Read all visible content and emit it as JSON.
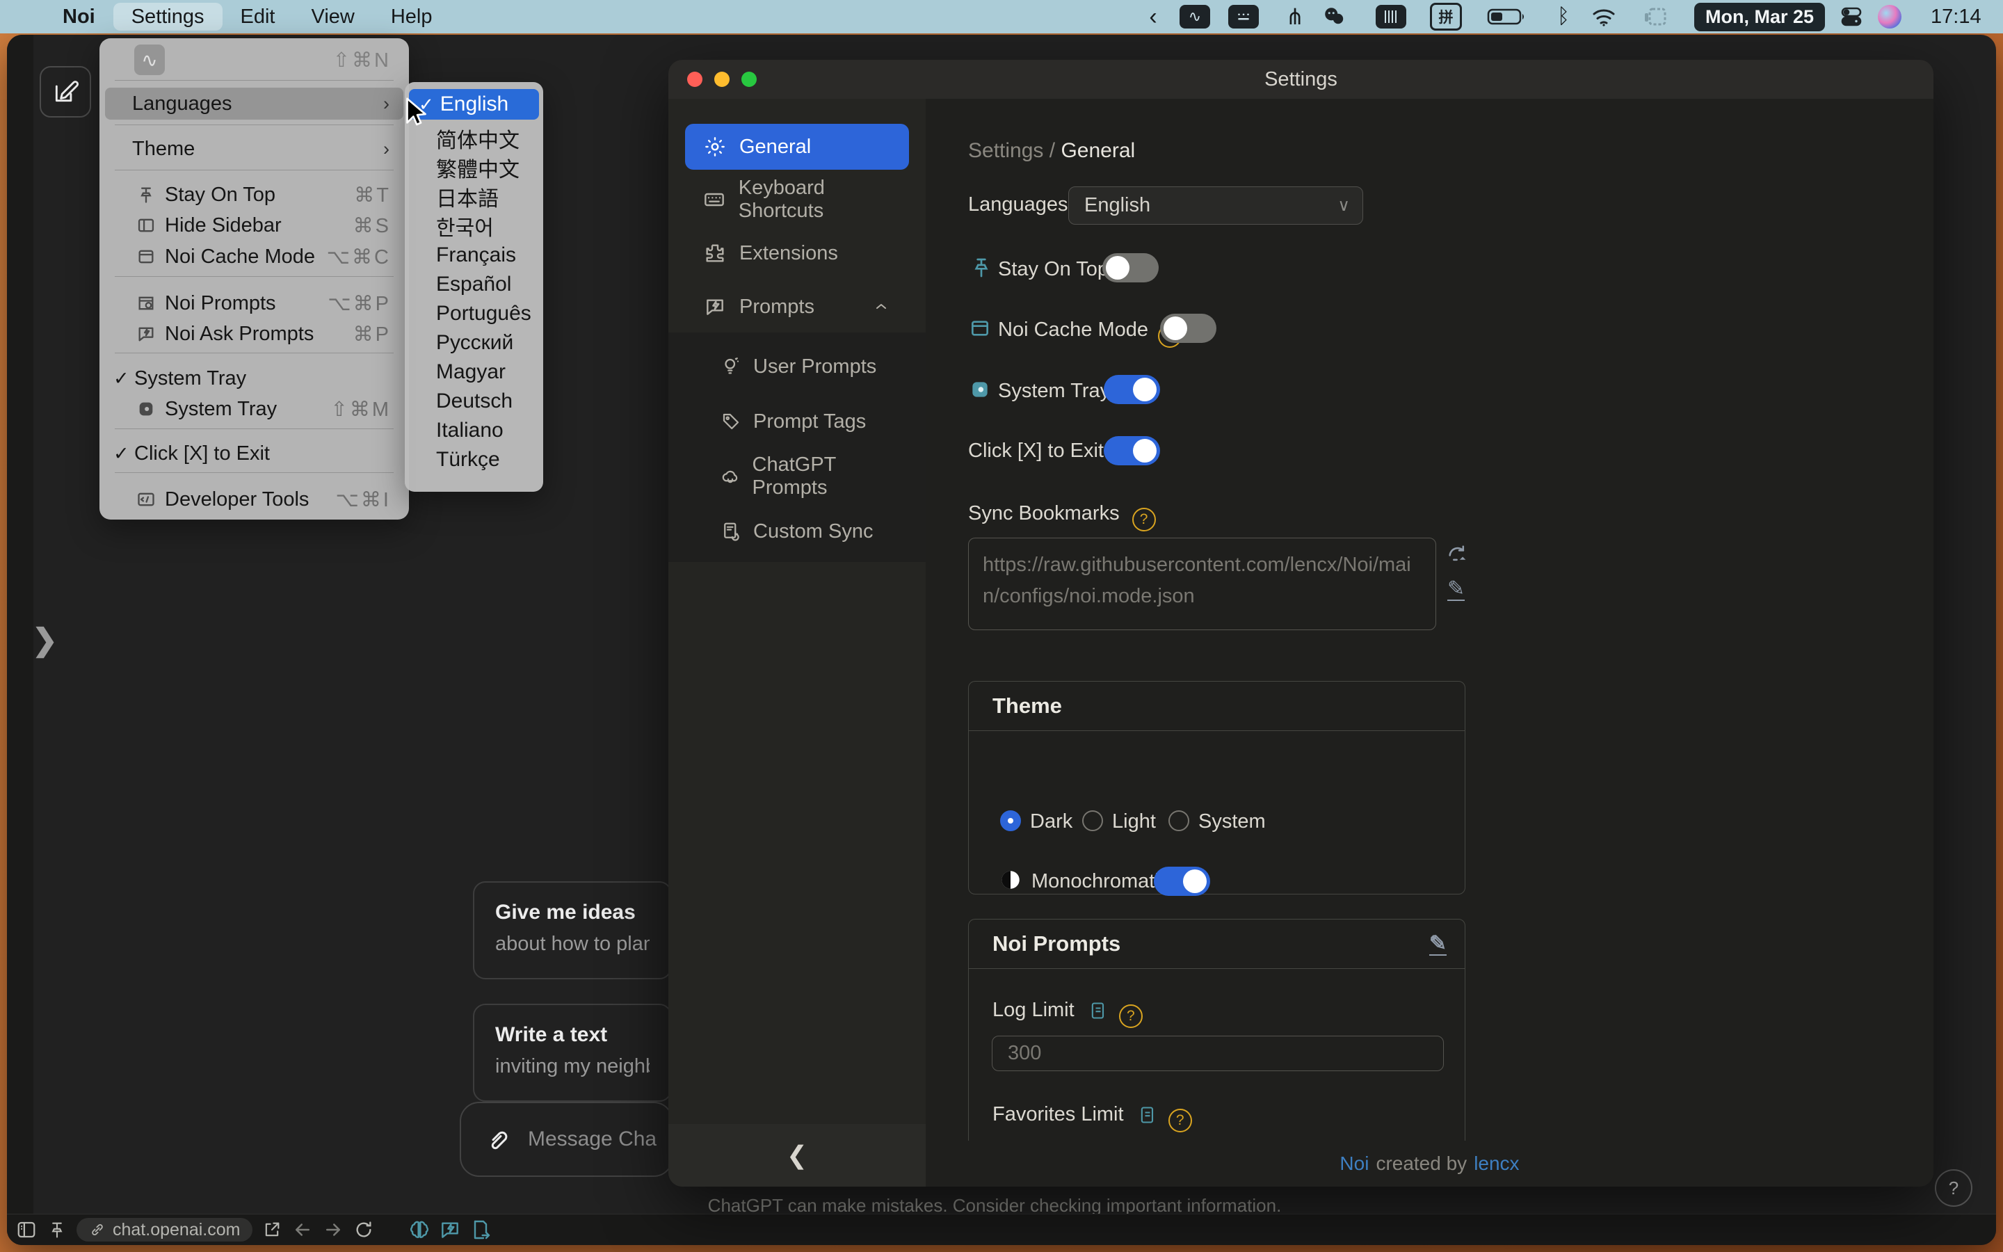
{
  "menubar": {
    "app": "Noi",
    "menus": [
      {
        "label": "Settings"
      },
      {
        "label": "Edit"
      },
      {
        "label": "View"
      },
      {
        "label": "Help"
      }
    ],
    "pinyin": "拼",
    "date": "Mon, Mar 25",
    "time": "17:14"
  },
  "settings_menu": {
    "shortcut_new": "⇧⌘N",
    "check": "✓",
    "arrow": "›",
    "items": [
      {
        "label": "Languages"
      },
      {
        "label": "Theme"
      },
      {
        "label": "Stay On Top",
        "shortcut": "⌘T"
      },
      {
        "label": "Hide Sidebar",
        "shortcut": "⌘S"
      },
      {
        "label": "Noi Cache Mode",
        "shortcut": "⌥⌘C"
      },
      {
        "label": "Noi Prompts",
        "shortcut": "⌥⌘P"
      },
      {
        "label": "Noi Ask Prompts",
        "shortcut": "⌘P"
      },
      {
        "label": "System Tray"
      },
      {
        "label": "System Tray",
        "shortcut": "⇧⌘M"
      },
      {
        "label": "Click [X] to Exit"
      },
      {
        "label": "Developer Tools",
        "shortcut": "⌥⌘I"
      }
    ]
  },
  "languages": {
    "check": "✓",
    "items": [
      "English",
      "简体中文",
      "繁體中文",
      "日本語",
      "한국어",
      "Français",
      "Español",
      "Português",
      "Русский",
      "Magyar",
      "Deutsch",
      "Italiano",
      "Türkçe"
    ]
  },
  "win": {
    "title": "Settings",
    "sidebar": {
      "items": [
        {
          "label": "General"
        },
        {
          "label": "Keyboard Shortcuts"
        },
        {
          "label": "Extensions"
        },
        {
          "label": "Prompts"
        }
      ],
      "sub": [
        {
          "label": "User Prompts"
        },
        {
          "label": "Prompt Tags"
        },
        {
          "label": "ChatGPT Prompts"
        },
        {
          "label": "Custom Sync"
        }
      ]
    },
    "breadcrumb": {
      "root": "Settings",
      "sep": "/",
      "cur": "General"
    },
    "qmark": "?",
    "rows": {
      "languages_label": "Languages :",
      "languages_value": "English",
      "stay": "Stay On Top :",
      "cache": "Noi Cache Mode",
      "cache_colon": ":",
      "tray": "System Tray :",
      "clickx": "Click [X] to Exit :",
      "sync": "Sync Bookmarks",
      "sync_placeholder": "https://raw.githubusercontent.com/lencx/Noi/main/configs/noi.mode.json"
    },
    "theme": {
      "title": "Theme",
      "dark": "Dark",
      "light": "Light",
      "system": "System",
      "mono": "Monochromatic :"
    },
    "prompts": {
      "title": "Noi Prompts",
      "log": "Log Limit",
      "log_placeholder": "300",
      "fav": "Favorites Limit"
    },
    "footer": {
      "a": "Noi",
      "b": "created by",
      "c": "lencx"
    }
  },
  "chat": {
    "cards": [
      {
        "title": "Give me ideas",
        "subtitle": "about how to plan m"
      },
      {
        "title": "Write a text",
        "subtitle": "inviting my neighbo"
      }
    ],
    "message": "Message Cha",
    "disclaimer": "ChatGPT can make mistakes. Consider checking important information.",
    "help": "?",
    "url": "chat.openai.com"
  }
}
